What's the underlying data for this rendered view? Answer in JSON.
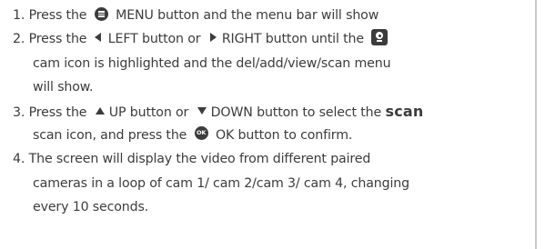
{
  "steps": [
    {
      "lines": [
        {
          "a": "1. Press the",
          "b": "MENU button and the menu bar will show"
        }
      ],
      "icons": [
        "menu-icon"
      ]
    },
    {
      "lines": [
        {
          "a": "2. Press the",
          "b": "LEFT button or",
          "c": "RIGHT button until the"
        },
        {
          "a": "cam icon is highlighted and the del/add/view/scan menu"
        },
        {
          "a": "will show."
        }
      ],
      "icons": [
        "left-triangle-icon",
        "right-triangle-icon",
        "cam-icon"
      ]
    },
    {
      "lines": [
        {
          "a": "3. Press the",
          "b": "UP button or",
          "c": "DOWN button to select  the",
          "d": "scan"
        },
        {
          "a": "scan icon, and press the",
          "b": "OK button to confirm."
        }
      ],
      "icons": [
        "up-triangle-icon",
        "down-triangle-icon",
        "ok-icon"
      ]
    },
    {
      "lines": [
        {
          "a": "4. The screen will  display the video from different paired"
        },
        {
          "a": "cameras in a loop of cam 1/ cam 2/cam 3/ cam 4, changing"
        },
        {
          "a": "every 10 seconds."
        }
      ],
      "icons": []
    }
  ],
  "ok_icon_text": "OK",
  "colors": {
    "text": "#3c3c3c",
    "rule": "#c9c9c9"
  }
}
